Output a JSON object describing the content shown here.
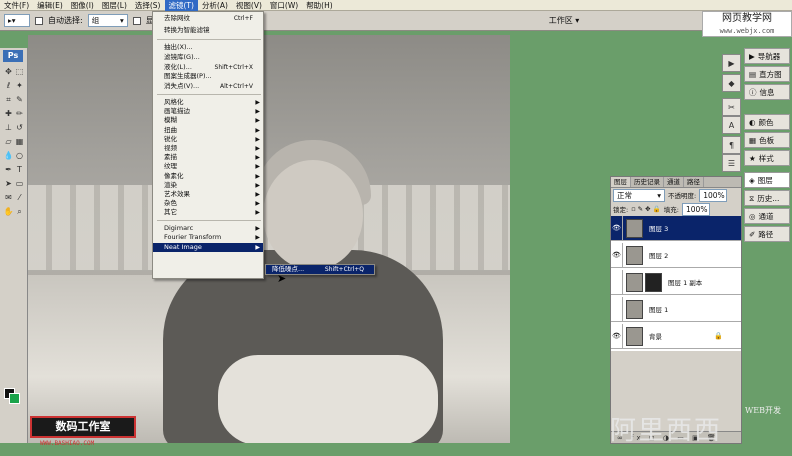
{
  "menubar": {
    "items": [
      "文件(F)",
      "编辑(E)",
      "图像(I)",
      "图层(L)",
      "选择(S)",
      "滤镜(T)",
      "分析(A)",
      "视图(V)",
      "窗口(W)",
      "帮助(H)"
    ],
    "active": "滤镜(T)"
  },
  "options": {
    "auto_select": "自动选择:",
    "group": "组",
    "show": "显",
    "workspace": "工作区 ▾"
  },
  "watermark": {
    "title": "网页教学网",
    "url": "www.webjx.com"
  },
  "filter_menu": {
    "top": [
      {
        "label": "去除网纹",
        "sc": "Ctrl+F"
      },
      {
        "label": "转换为智能滤镜",
        "sc": ""
      }
    ],
    "group2": [
      {
        "label": "抽出(X)...",
        "sc": ""
      },
      {
        "label": "滤镜库(G)...",
        "sc": ""
      },
      {
        "label": "液化(L)...",
        "sc": "Shift+Ctrl+X"
      },
      {
        "label": "图案生成器(P)...",
        "sc": ""
      },
      {
        "label": "消失点(V)...",
        "sc": "Alt+Ctrl+V"
      }
    ],
    "group3": [
      "风格化",
      "画笔描边",
      "模糊",
      "扭曲",
      "锐化",
      "视频",
      "素描",
      "纹理",
      "像素化",
      "渲染",
      "艺术效果",
      "杂色",
      "其它"
    ],
    "group4": [
      "Digimarc",
      "Fourier Transform",
      "Neat Image"
    ]
  },
  "submenu": {
    "label": "降低噪点...",
    "sc": "Shift+Ctrl+Q"
  },
  "layers_panel": {
    "tabs": [
      "图层",
      "历史记录",
      "通道",
      "路径"
    ],
    "blend": "正常",
    "opacity_label": "不透明度:",
    "opacity": "100%",
    "lock_label": "锁定:",
    "fill_label": "填充:",
    "fill": "100%",
    "layers": [
      {
        "name": "图层 3",
        "selected": true,
        "eye": true
      },
      {
        "name": "图层 2",
        "selected": false,
        "eye": true
      },
      {
        "name": "图层 1 副本",
        "selected": false,
        "eye": false,
        "mask": true
      },
      {
        "name": "图层 1",
        "selected": false,
        "eye": false
      },
      {
        "name": "背景",
        "selected": false,
        "eye": true,
        "locked": true
      }
    ],
    "footer": "∞ fx ◻ ◑ ▭ ▣ 🗑"
  },
  "dock": {
    "group1": [
      "导航器",
      "直方图",
      "信息"
    ],
    "group2": [
      "颜色",
      "色板",
      "样式"
    ],
    "group3": [
      "图层",
      "历史...",
      "通道",
      "路径"
    ]
  },
  "logo_left": {
    "text": "数码工作室",
    "sub": "WWW.BASHIAO.COM"
  },
  "logo_right": {
    "text": "阿里西西",
    "sub": "WEB开发"
  },
  "colors": {
    "foreground": "#111111",
    "background": "#1aa34a"
  }
}
